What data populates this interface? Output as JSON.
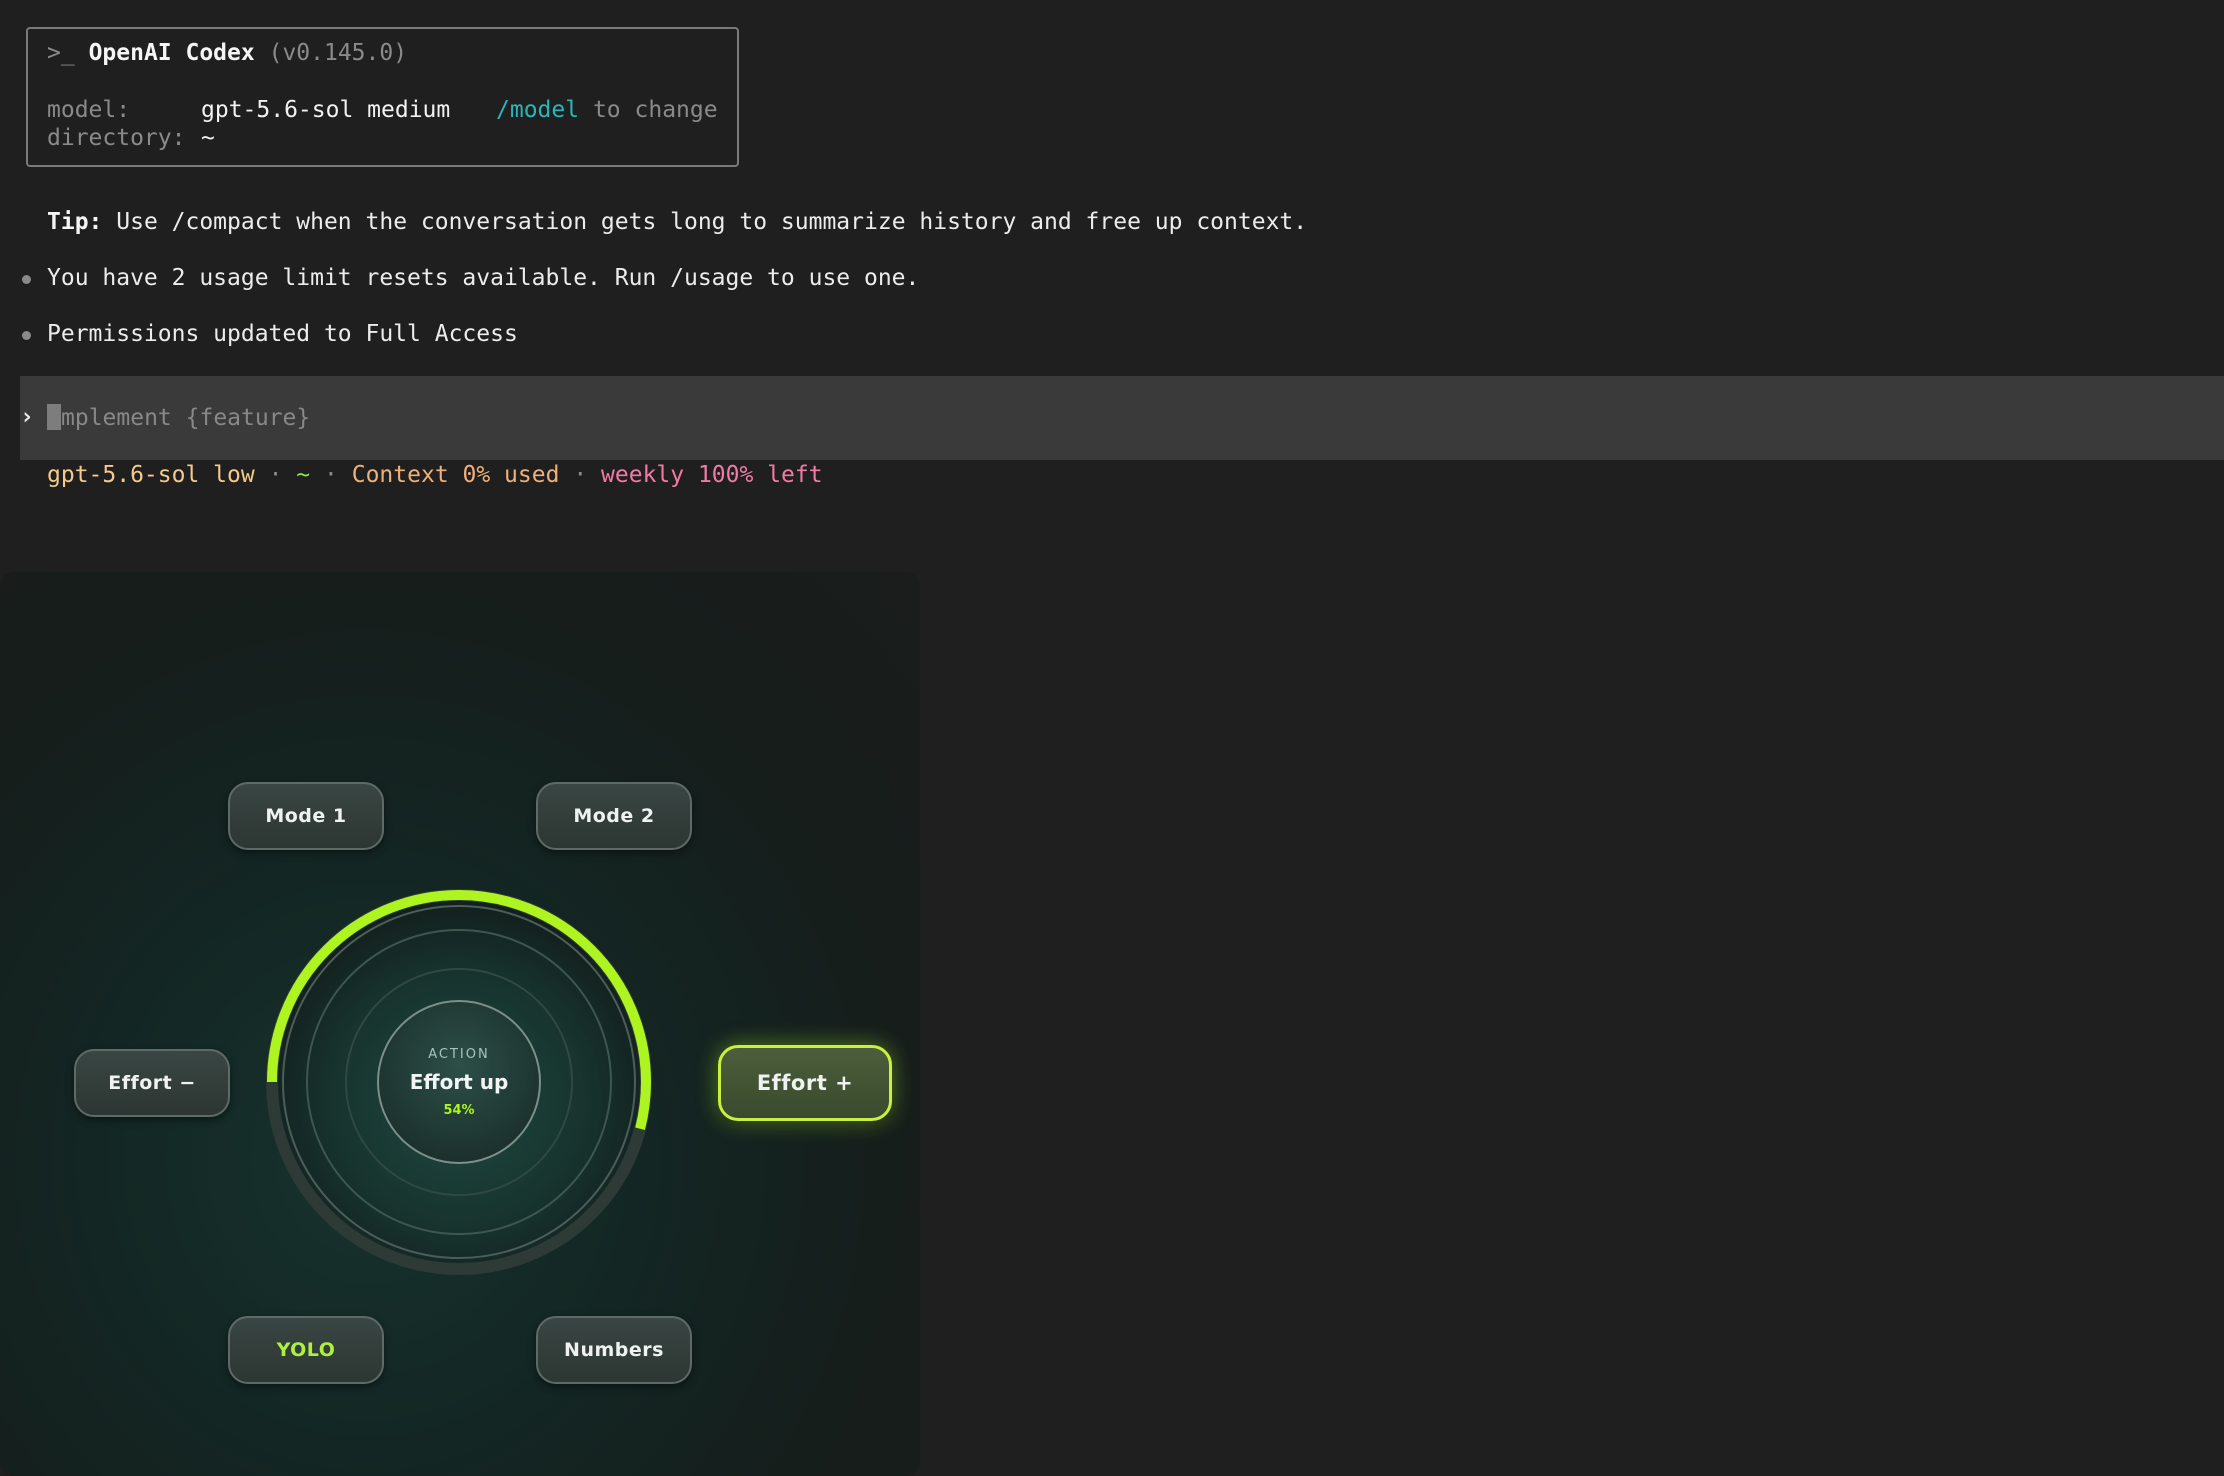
{
  "header": {
    "prompt_glyph": ">_",
    "app_name": "OpenAI Codex",
    "version": "(v0.145.0)",
    "model_label": "model:",
    "model_value": "gpt-5.6-sol medium",
    "model_cmd": "/model",
    "model_hint": "to change",
    "directory_label": "directory:",
    "directory_value": "~"
  },
  "messages": {
    "tip_label": "Tip:",
    "tip_text": "Use /compact when the conversation gets long to summarize history and free up context.",
    "items": [
      "You have 2 usage limit resets available. Run /usage to use one.",
      "Permissions updated to Full Access"
    ]
  },
  "input": {
    "prompt": "›",
    "placeholder": "mplement {feature}"
  },
  "status": {
    "model": "gpt-5.6-sol low",
    "sep": "·",
    "dir": "~",
    "context": "Context 0% used",
    "weekly": "weekly 100% left"
  },
  "controller": {
    "mode1": "Mode 1",
    "mode2": "Mode 2",
    "effort_minus": "Effort −",
    "effort_plus": "Effort +",
    "yolo": "YOLO",
    "numbers": "Numbers",
    "center_caption": "ACTION",
    "center_title": "Effort up",
    "center_percent": "54%",
    "progress_fraction": 0.54
  },
  "colors": {
    "accent": "#aef420",
    "cyan": "#2bb5b8",
    "status_model": "#f5c98a",
    "status_context": "#f0b07a",
    "status_weekly": "#f27aa6",
    "status_dir": "#8ee04a"
  }
}
